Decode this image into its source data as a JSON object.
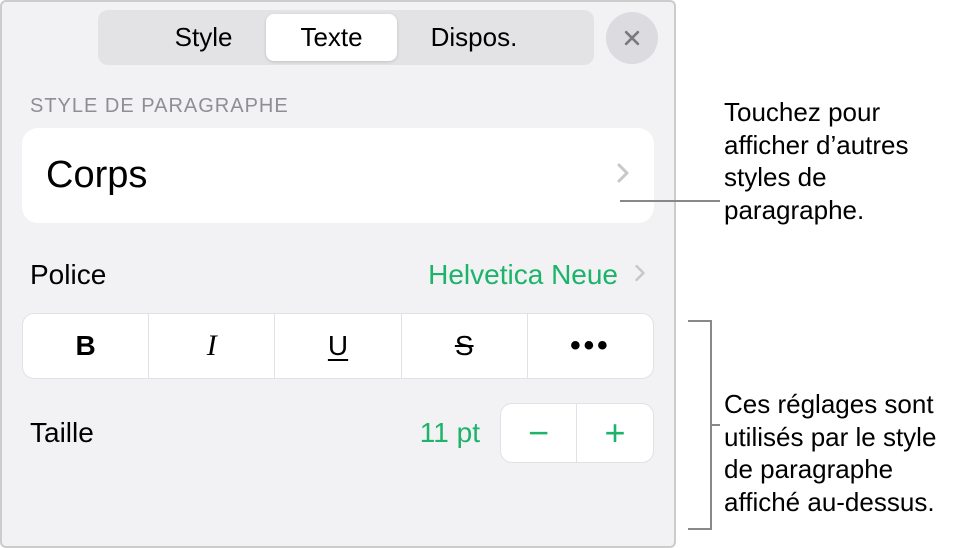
{
  "tabs": {
    "style": "Style",
    "texte": "Texte",
    "dispos": "Dispos."
  },
  "section": {
    "paragraph_style_label": "STYLE DE PARAGRAPHE"
  },
  "paragraph_style": {
    "name": "Corps"
  },
  "font": {
    "label": "Police",
    "value": "Helvetica Neue"
  },
  "styles": {
    "bold": "B",
    "italic": "I",
    "underline": "U",
    "strike": "S",
    "more": "•••"
  },
  "size": {
    "label": "Taille",
    "value": "11 pt",
    "minus": "−",
    "plus": "+"
  },
  "callouts": {
    "c1": "Touchez pour afficher d’autres styles de paragraphe.",
    "c2": "Ces réglages sont utilisés par le style de paragraphe affiché au-dessus."
  }
}
